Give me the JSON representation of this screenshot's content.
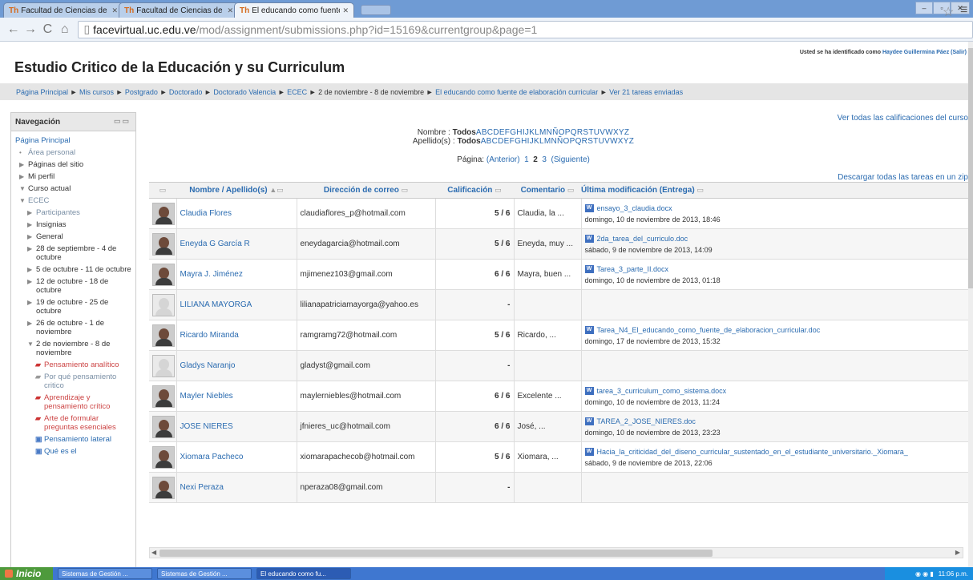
{
  "browser": {
    "tabs": [
      {
        "label": "Facultad de Ciencias de la E"
      },
      {
        "label": "Facultad de Ciencias de la E"
      },
      {
        "label": "El educando como fuente de"
      }
    ],
    "url": {
      "domain": "facevirtual.uc.edu.ve",
      "path": "/mod/assignment/submissions.php?id=15169&currentgroup&page=1"
    },
    "window_buttons": [
      "–",
      "▫",
      "✕"
    ]
  },
  "header": {
    "title": "Estudio Critico de la Educación y su Curriculum",
    "login_prefix": "Usted se ha identificado como",
    "login_user": "Haydee Guillermina Páez",
    "logout": "(Salir)"
  },
  "breadcrumb": [
    "Página Principal",
    "Mis cursos",
    "Postgrado",
    "Doctorado",
    "Doctorado Valencia",
    "ECEC",
    "2 de noviembre - 8 de noviembre",
    "El educando como fuente de elaboración curricular",
    "Ver 21 tareas enviadas"
  ],
  "sidebar": {
    "title": "Navegación",
    "items": [
      {
        "label": "Página Principal",
        "indent": 0,
        "arrow": "",
        "style": "link"
      },
      {
        "label": "Área personal",
        "indent": 1,
        "arrow": "•",
        "style": "grey"
      },
      {
        "label": "Páginas del sitio",
        "indent": 1,
        "arrow": "▶",
        "style": "plain"
      },
      {
        "label": "Mi perfil",
        "indent": 1,
        "arrow": "▶",
        "style": "plain"
      },
      {
        "label": "Curso actual",
        "indent": 1,
        "arrow": "▼",
        "style": "plain"
      },
      {
        "label": "ECEC",
        "indent": 2,
        "arrow": "▼",
        "style": "grey"
      },
      {
        "label": "Participantes",
        "indent": 3,
        "arrow": "▶",
        "style": "grey"
      },
      {
        "label": "Insignias",
        "indent": 3,
        "arrow": "▶",
        "style": "plain"
      },
      {
        "label": "General",
        "indent": 3,
        "arrow": "▶",
        "style": "plain"
      },
      {
        "label": "28 de septiembre - 4 de octubre",
        "indent": 3,
        "arrow": "▶",
        "style": "plain"
      },
      {
        "label": "5 de octubre - 11 de octubre",
        "indent": 3,
        "arrow": "▶",
        "style": "plain"
      },
      {
        "label": "12 de octubre - 18 de octubre",
        "indent": 3,
        "arrow": "▶",
        "style": "plain"
      },
      {
        "label": "19 de octubre - 25 de octubre",
        "indent": 3,
        "arrow": "▶",
        "style": "plain"
      },
      {
        "label": "26 de octubre - 1 de noviembre",
        "indent": 3,
        "arrow": "▶",
        "style": "plain"
      },
      {
        "label": "2 de noviembre - 8 de noviembre",
        "indent": 3,
        "arrow": "▼",
        "style": "plain"
      },
      {
        "label": "Pensamiento analítico",
        "indent": 4,
        "arrow": "",
        "style": "red",
        "icon": "assignment-icon"
      },
      {
        "label": "Por qué pensamiento critico",
        "indent": 4,
        "arrow": "",
        "style": "grey",
        "icon": "forum-icon"
      },
      {
        "label": "Aprendizaje y pensamiento crítico",
        "indent": 4,
        "arrow": "",
        "style": "red",
        "icon": "assignment-icon"
      },
      {
        "label": "Arte de formular preguntas esenciales",
        "indent": 4,
        "arrow": "",
        "style": "red",
        "icon": "assignment-icon"
      },
      {
        "label": "Pensamiento lateral",
        "indent": 4,
        "arrow": "",
        "style": "link",
        "icon": "resource-icon"
      },
      {
        "label": "Qué es el",
        "indent": 4,
        "arrow": "",
        "style": "link",
        "icon": "resource-icon"
      }
    ]
  },
  "main": {
    "view_all_grades": "Ver todas las calificaciones del curso",
    "filter_first_label": "Nombre :",
    "filter_last_label": "Apellido(s) :",
    "filter_all": "Todos",
    "letters": "ABCDEFGHIJKLMNÑOPQRSTUVWXYZ",
    "pager_label": "Página:",
    "pager_prev": "(Anterior)",
    "pager_pages": [
      "1",
      "2",
      "3"
    ],
    "pager_next": "(Siguiente)",
    "download_all": "Descargar todas las tareas en un zip",
    "columns": {
      "name": "Nombre / Apellido(s)",
      "email": "Dirección de correo",
      "grade": "Calificación",
      "comment": "Comentario",
      "last_modified": "Última modificación (Entrega)"
    },
    "rows": [
      {
        "name": "Claudia Flores",
        "email": "claudiaflores_p@hotmail.com",
        "grade": "5 / 6",
        "comment": "Claudia, la ...",
        "file": "ensayo_3_claudia.docx",
        "date": "domingo, 10 de noviembre de 2013, 18:46",
        "avatar": "photo"
      },
      {
        "name": "Eneyda G García R",
        "email": "eneydagarcia@hotmail.com",
        "grade": "5 / 6",
        "comment": "Eneyda, muy ...",
        "file": "2da_tarea_del_curriculo.doc",
        "date": "sábado, 9 de noviembre de 2013, 14:09",
        "avatar": "photo"
      },
      {
        "name": "Mayra J. Jiménez",
        "email": "mjimenez103@gmail.com",
        "grade": "6 / 6",
        "comment": "Mayra, buen ...",
        "file": "Tarea_3_parte_II.docx",
        "date": "domingo, 10 de noviembre de 2013, 01:18",
        "avatar": "photo"
      },
      {
        "name": "LILIANA MAYORGA",
        "email": "lilianapatriciamayorga@yahoo.es",
        "grade": "-",
        "comment": "",
        "file": "",
        "date": "",
        "avatar": "blank"
      },
      {
        "name": "Ricardo Miranda",
        "email": "ramgramg72@hotmail.com",
        "grade": "5 / 6",
        "comment": "Ricardo, ...",
        "file": "Tarea_N4_El_educando_como_fuente_de_elaboracion_curricular.doc",
        "date": "domingo, 17 de noviembre de 2013, 15:32",
        "avatar": "photo"
      },
      {
        "name": "Gladys Naranjo",
        "email": "gladyst@gmail.com",
        "grade": "-",
        "comment": "",
        "file": "",
        "date": "",
        "avatar": "blank"
      },
      {
        "name": "Mayler Niebles",
        "email": "maylerniebles@hotmail.com",
        "grade": "6 / 6",
        "comment": "Excelente ...",
        "file": "tarea_3_curriculum_como_sistema.docx",
        "date": "domingo, 10 de noviembre de 2013, 11:24",
        "avatar": "photo"
      },
      {
        "name": "JOSE NIERES",
        "email": "jfnieres_uc@hotmail.com",
        "grade": "6 / 6",
        "comment": "José, ...",
        "file": "TAREA_2_JOSE_NIERES.doc",
        "date": "domingo, 10 de noviembre de 2013, 23:23",
        "avatar": "photo"
      },
      {
        "name": "Xiomara Pacheco",
        "email": "xiomarapachecob@hotmail.com",
        "grade": "5 / 6",
        "comment": "Xiomara, ...",
        "file": "Hacia_la_criticidad_del_diseno_curricular_sustentado_en_el_estudiante_universitario._Xiomara_",
        "date": "sábado, 9 de noviembre de 2013, 22:06",
        "avatar": "photo"
      },
      {
        "name": "Nexi Peraza",
        "email": "nperaza08@gmail.com",
        "grade": "-",
        "comment": "",
        "file": "",
        "date": "",
        "avatar": "photo"
      }
    ]
  },
  "taskbar": {
    "start": "Inicio",
    "items": [
      "Sistemas de Gestión ...",
      "Sistemas de Gestión ...",
      "El educando como fu..."
    ],
    "clock": "11:06 p.m."
  }
}
